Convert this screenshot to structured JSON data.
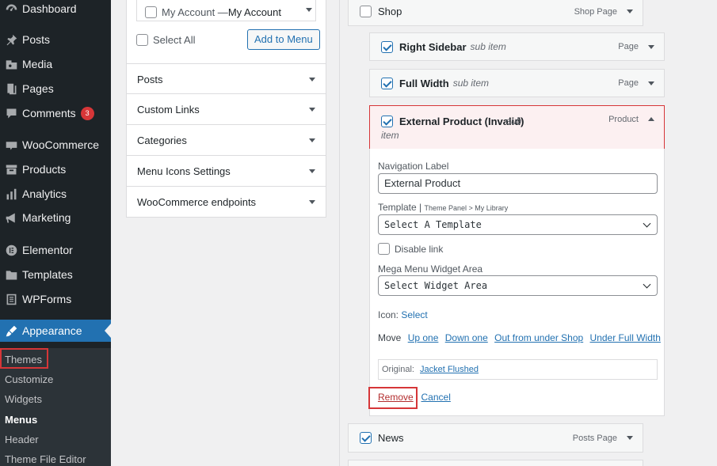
{
  "sidebar": {
    "items": [
      {
        "label": "Dashboard",
        "icon": "dashboard-icon"
      },
      {
        "label": "Posts",
        "icon": "pin-icon"
      },
      {
        "label": "Media",
        "icon": "media-icon"
      },
      {
        "label": "Pages",
        "icon": "pages-icon"
      },
      {
        "label": "Comments",
        "icon": "comment-icon",
        "badge": "3"
      },
      {
        "label": "WooCommerce",
        "icon": "woocommerce-icon"
      },
      {
        "label": "Products",
        "icon": "archive-icon"
      },
      {
        "label": "Analytics",
        "icon": "bar-chart-icon"
      },
      {
        "label": "Marketing",
        "icon": "megaphone-icon"
      },
      {
        "label": "Elementor",
        "icon": "elementor-icon"
      },
      {
        "label": "Templates",
        "icon": "folder-icon"
      },
      {
        "label": "WPForms",
        "icon": "forms-icon"
      },
      {
        "label": "Appearance",
        "icon": "paintbrush-icon",
        "active": true
      }
    ],
    "submenu": [
      "Themes",
      "Customize",
      "Widgets",
      "Menus",
      "Header",
      "Theme File Editor"
    ],
    "current_submenu": "Menus",
    "accent": "#2271b1"
  },
  "add_items": {
    "list_item_label": "My Account — ",
    "list_item_bold": "My Account",
    "select_all": "Select All",
    "add_button": "Add to Menu",
    "sections": [
      "Posts",
      "Custom Links",
      "Categories",
      "Menu Icons Settings",
      "WooCommerce endpoints"
    ]
  },
  "menu_structure": {
    "shop": {
      "title": "Shop",
      "type": "Shop Page"
    },
    "right_sidebar": {
      "title": "Right Sidebar",
      "sub": "sub item",
      "type": "Page"
    },
    "full_width": {
      "title": "Full Width",
      "sub": "sub item",
      "type": "Page"
    },
    "external": {
      "title": "External Product (Invalid)",
      "sub": "sub",
      "sub2": "item",
      "type": "Product"
    },
    "news": {
      "title": "News",
      "type": "Posts Page"
    }
  },
  "item_settings": {
    "nav_label_title": "Navigation Label",
    "nav_label_value": "External Product",
    "template_title": "Template |",
    "template_hint": "Theme Panel > My Library",
    "template_value": "Select A Template",
    "disable_link": "Disable link",
    "mega_title": "Mega Menu Widget Area",
    "mega_value": "Select Widget Area",
    "icon_label": "Icon:",
    "icon_link": "Select",
    "move_label": "Move",
    "move_links": [
      "Up one",
      "Down one",
      "Out from under Shop",
      "Under Full Width"
    ],
    "original_label": "Original:",
    "original_link": "Jacket Flushed",
    "remove": "Remove",
    "separator": "|",
    "cancel": "Cancel"
  },
  "highlight_color": "#d63638"
}
